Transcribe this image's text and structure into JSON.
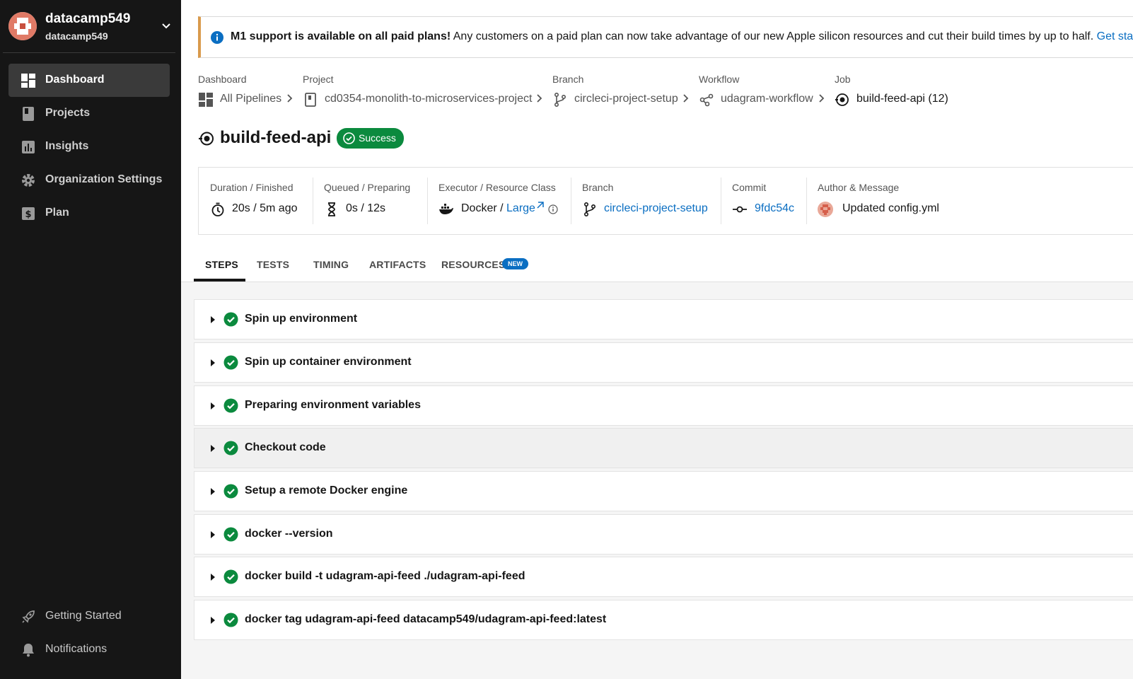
{
  "sidebar": {
    "org_name": "datacamp549",
    "org_sub": "datacamp549",
    "items": [
      {
        "label": "Dashboard",
        "icon": "dashboard-icon",
        "active": true
      },
      {
        "label": "Projects",
        "icon": "projects-icon"
      },
      {
        "label": "Insights",
        "icon": "insights-icon"
      },
      {
        "label": "Organization Settings",
        "icon": "gear-icon"
      },
      {
        "label": "Plan",
        "icon": "dollar-icon"
      }
    ],
    "bottom_items": [
      {
        "label": "Getting Started",
        "icon": "rocket-icon"
      },
      {
        "label": "Notifications",
        "icon": "bell-icon"
      }
    ]
  },
  "banner": {
    "bold": "M1 support is available on all paid plans!",
    "text": " Any customers on a paid plan can now take advantage of our new Apple silicon resources and cut their build times by up to half. ",
    "link": "Get started"
  },
  "breadcrumbs": [
    {
      "label": "Dashboard",
      "value": "All Pipelines"
    },
    {
      "label": "Project",
      "value": "cd0354-monolith-to-microservices-project"
    },
    {
      "label": "Branch",
      "value": "circleci-project-setup"
    },
    {
      "label": "Workflow",
      "value": "udagram-workflow"
    },
    {
      "label": "Job",
      "value": "build-feed-api (12)"
    }
  ],
  "job": {
    "title": "build-feed-api",
    "status": "Success"
  },
  "meta": {
    "duration": {
      "label": "Duration / Finished",
      "value": "20s / 5m ago"
    },
    "queued": {
      "label": "Queued / Preparing",
      "value": "0s / 12s"
    },
    "executor": {
      "label": "Executor / Resource Class",
      "value": "Docker / ",
      "link": "Large"
    },
    "branch": {
      "label": "Branch",
      "value": "circleci-project-setup"
    },
    "commit": {
      "label": "Commit",
      "value": "9fdc54c"
    },
    "author": {
      "label": "Author & Message",
      "value": "Updated config.yml"
    }
  },
  "tabs": [
    "STEPS",
    "TESTS",
    "TIMING",
    "ARTIFACTS",
    "RESOURCES"
  ],
  "new_badge": "NEW",
  "steps": [
    "Spin up environment",
    "Spin up container environment",
    "Preparing environment variables",
    "Checkout code",
    "Setup a remote Docker engine",
    "docker --version",
    "docker build -t udagram-api-feed ./udagram-api-feed",
    "docker tag udagram-api-feed datacamp549/udagram-api-feed:latest"
  ],
  "colors": {
    "sidebar_bg": "#161616",
    "success": "#0b8a3e",
    "link": "#0a6ec2",
    "banner_accent": "#d99a4c"
  }
}
